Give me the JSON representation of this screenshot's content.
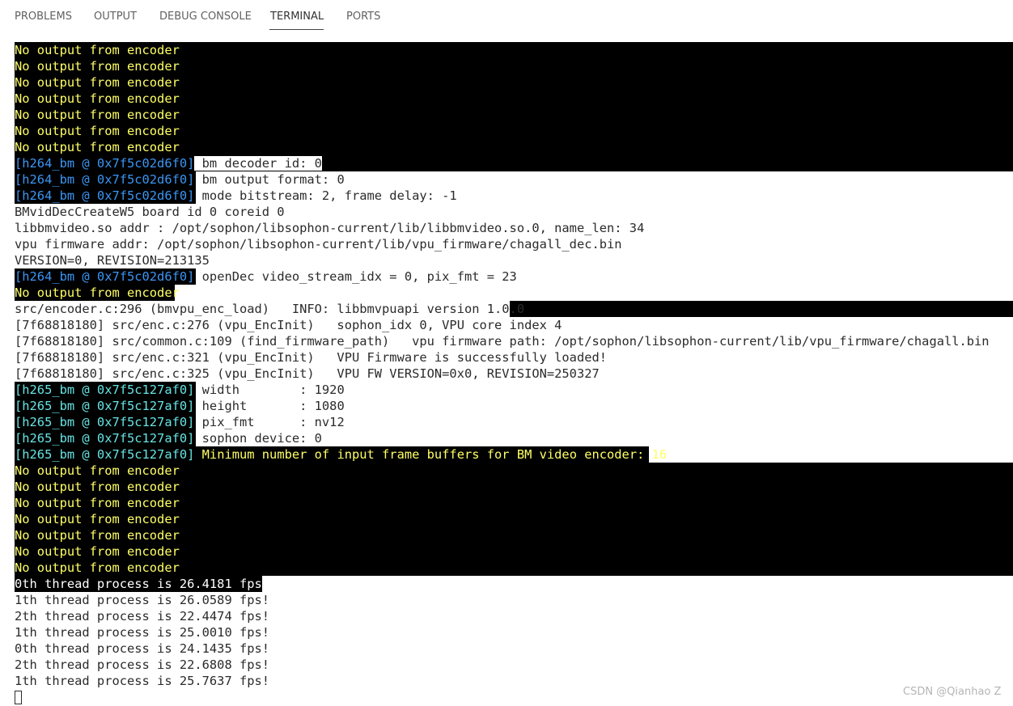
{
  "panel": {
    "tabs": [
      {
        "label": "PROBLEMS"
      },
      {
        "label": "OUTPUT"
      },
      {
        "label": "DEBUG CONSOLE"
      },
      {
        "label": "TERMINAL",
        "active": true
      },
      {
        "label": "PORTS"
      }
    ]
  },
  "terminal": {
    "lines": [
      "No output from encoder",
      "No output from encoder",
      "No output from encoder",
      "No output from encoder",
      "No output from encoder",
      "No output from encoder",
      "No output from encoder",
      {
        "prefix": "[h264_bm @ 0x7f5c02d6f0]",
        "text": " bm decoder id: 0"
      },
      {
        "prefix": "[h264_bm @ 0x7f5c02d6f0]",
        "text": " bm output format: 0"
      },
      {
        "prefix": "[h264_bm @ 0x7f5c02d6f0]",
        "text": " mode bitstream: 2, frame delay: -1"
      },
      "BMvidDecCreateW5 board id 0 coreid 0",
      "libbmvideo.so addr : /opt/sophon/libsophon-current/lib/libbmvideo.so.0, name_len: 34",
      "vpu firmware addr: /opt/sophon/libsophon-current/lib/vpu_firmware/chagall_dec.bin",
      "VERSION=0, REVISION=213135",
      {
        "prefix": "[h264_bm @ 0x7f5c02d6f0]",
        "text": " openDec video_stream_idx = 0, pix_fmt = 23"
      },
      "No output from encoder",
      "src/encoder.c:296 (bmvpu_enc_load)   INFO: libbmvpuapi version 1.0.0",
      "[7f68818180] src/enc.c:276 (vpu_EncInit)   sophon_idx 0, VPU core index 4",
      "[7f68818180] src/common.c:109 (find_firmware_path)   vpu firmware path: /opt/sophon/libsophon-current/lib/vpu_firmware/chagall.bin",
      "[7f68818180] src/enc.c:321 (vpu_EncInit)   VPU Firmware is successfully loaded!",
      "[7f68818180] src/enc.c:325 (vpu_EncInit)   VPU FW VERSION=0x0, REVISION=250327",
      {
        "prefix": "[h265_bm @ 0x7f5c127af0]",
        "text": " width        : 1920"
      },
      {
        "prefix": "[h265_bm @ 0x7f5c127af0]",
        "text": " height       : 1080"
      },
      {
        "prefix": "[h265_bm @ 0x7f5c127af0]",
        "text": " pix_fmt      : nv12"
      },
      {
        "prefix": "[h265_bm @ 0x7f5c127af0]",
        "text": " sophon device: 0"
      },
      {
        "prefix": "[h265_bm @ 0x7f5c127af0]",
        "text": " Minimum number of input frame buffers for BM video encoder: 16"
      },
      "No output from encoder",
      "No output from encoder",
      "No output from encoder",
      "No output from encoder",
      "No output from encoder",
      "No output from encoder",
      "No output from encoder",
      "0th thread process is 26.4181 fps!",
      "1th thread process is 26.0589 fps!",
      "2th thread process is 22.4474 fps!",
      "1th thread process is 25.0010 fps!",
      "0th thread process is 24.1435 fps!",
      "2th thread process is 22.6808 fps!",
      "1th thread process is 25.7637 fps!"
    ]
  },
  "watermark": "CSDN @Qianhao Z",
  "colors": {
    "terminal_bg_block": "#000000",
    "yellow_text": "#ffff66",
    "blue_prefix": "#3a96f5",
    "cyan_prefix": "#66e3e3",
    "default_text": "#2b2b2b"
  }
}
